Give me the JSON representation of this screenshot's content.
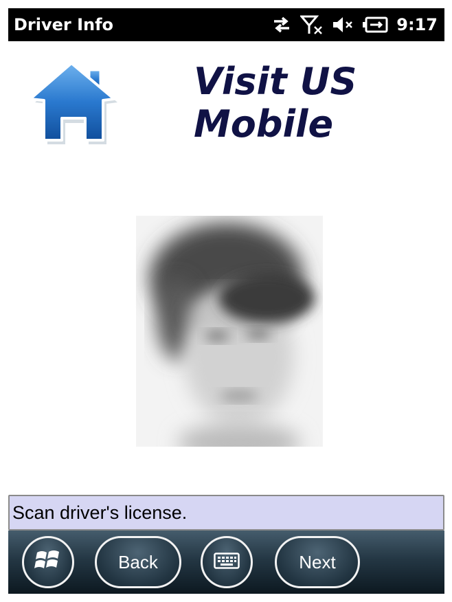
{
  "titlebar": {
    "title": "Driver Info",
    "time": "9:17",
    "icons": [
      "data-sync-icon",
      "no-signal-icon",
      "speaker-muted-icon",
      "battery-charging-icon"
    ]
  },
  "header": {
    "home_icon": "home-icon",
    "brand_line1": "Visit US",
    "brand_line2": "Mobile",
    "brand_color": "#101245",
    "home_color": "#1f6fc4"
  },
  "main": {
    "photo": "driver-photo"
  },
  "prompt": {
    "text": "Scan driver's license."
  },
  "softkeys": {
    "start_icon": "windows-start-icon",
    "back_label": "Back",
    "keyboard_icon": "keyboard-icon",
    "next_label": "Next"
  }
}
